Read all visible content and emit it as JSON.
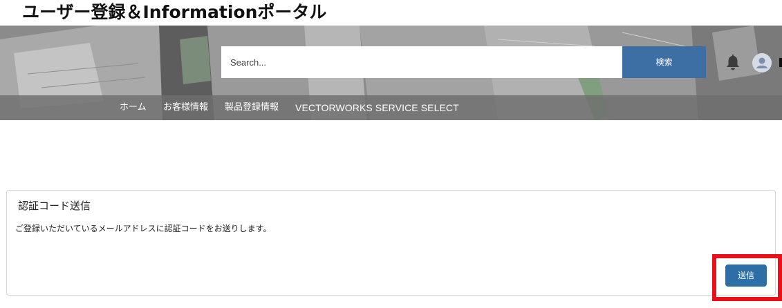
{
  "header": {
    "title": "ユーザー登録＆Informationポータル"
  },
  "search": {
    "placeholder": "Search...",
    "button_label": "検索"
  },
  "icons": {
    "notification": "bell-icon",
    "profile": "user-avatar-icon"
  },
  "nav": {
    "items": [
      {
        "label": "ホーム"
      },
      {
        "label": "お客様情報"
      },
      {
        "label": "製品登録情報"
      },
      {
        "label": "VECTORWORKS SERVICE SELECT"
      }
    ]
  },
  "card": {
    "title": "認証コード送信",
    "message": "ご登録いただいているメールアドレスに認証コードをお送りします。",
    "send_label": "送信"
  },
  "colors": {
    "accent": "#3d6fa5",
    "send_button": "#2e6ea6",
    "highlight": "#e8101a",
    "nav_bar": "#6e6e6e"
  }
}
